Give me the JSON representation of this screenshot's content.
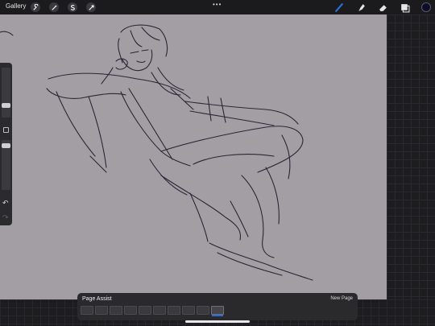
{
  "topbar": {
    "gallery_label": "Gallery",
    "left_tools": [
      "wrench-icon",
      "magic-wand-icon",
      "selection-icon",
      "transform-arrow-icon"
    ],
    "more_label": "•••",
    "right_tools": [
      "brush-icon",
      "smudge-icon",
      "eraser-icon",
      "layers-icon"
    ],
    "active_tool": "brush-icon",
    "brush_color": "#2a6fd6",
    "current_color": "#0d0d2a"
  },
  "sidebar": {
    "undo_icon": "↶",
    "redo_icon": "↷"
  },
  "canvas": {
    "background": "#a39ea4",
    "stroke_color": "#2a2636"
  },
  "page_assist": {
    "title": "Page Assist",
    "new_page": "New Page",
    "page_count": 10,
    "active_page": 10
  }
}
